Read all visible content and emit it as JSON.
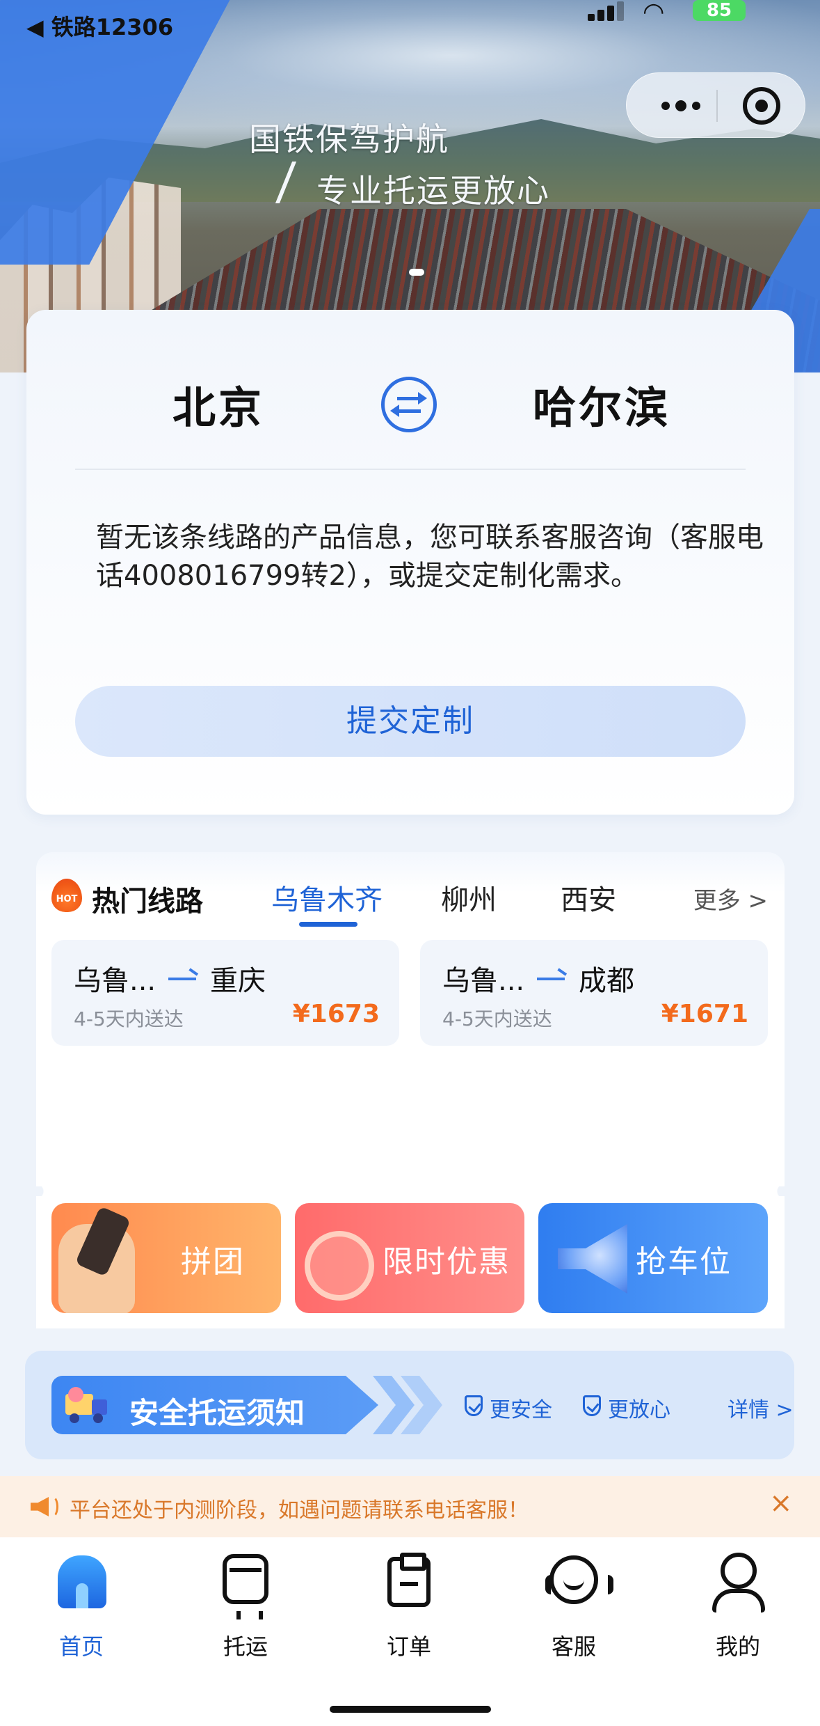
{
  "status_bar": {
    "back_app": "◀ 铁路12306",
    "battery": "85"
  },
  "banner": {
    "line1": "国铁保驾护航",
    "line2": "专业托运更放心"
  },
  "route": {
    "from_city": "北京",
    "to_city": "哈尔滨",
    "notice": "暂无该条线路的产品信息，您可联系客服咨询（客服电话4008016799转2），或提交定制化需求。",
    "submit_label": "提交定制"
  },
  "hot_routes": {
    "badge": "HOT",
    "title": "热门线路",
    "tabs": [
      {
        "label": "乌鲁木齐",
        "active": true
      },
      {
        "label": "柳州",
        "active": false
      },
      {
        "label": "西安",
        "active": false
      }
    ],
    "more_label": "更多 >",
    "items": [
      {
        "from": "乌鲁...",
        "to": "重庆",
        "eta": "4-5天内送达",
        "price": "¥1673"
      },
      {
        "from": "乌鲁...",
        "to": "成都",
        "eta": "4-5天内送达",
        "price": "¥1671"
      }
    ]
  },
  "promos": {
    "group": "拼团",
    "sale": "限时优惠",
    "seat": "抢车位"
  },
  "safety": {
    "title": "安全托运须知",
    "tag1": "更安全",
    "tag2": "更放心",
    "detail": "详情 >"
  },
  "marquee": {
    "text": "平台还处于内测阶段，如遇问题请联系电话客服！",
    "close": "×"
  },
  "tabbar": {
    "home": "首页",
    "ship": "托运",
    "order": "订单",
    "service": "客服",
    "mine": "我的"
  },
  "colors": {
    "accent": "#1f63d6",
    "price": "#f36a1c",
    "marquee_text": "#d9782a"
  }
}
